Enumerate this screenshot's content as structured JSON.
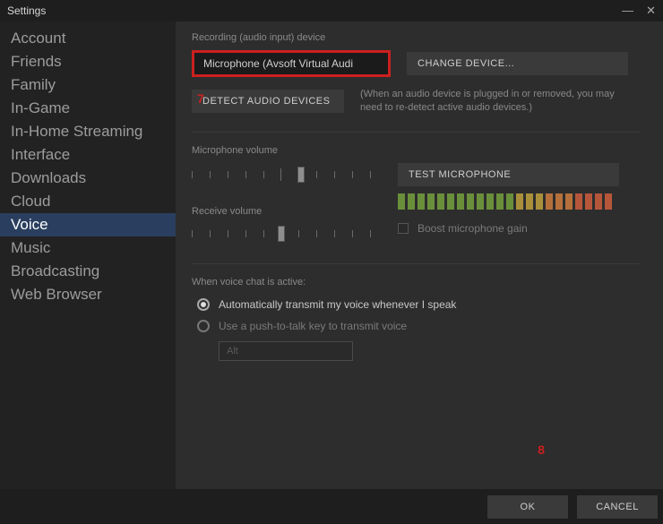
{
  "window": {
    "title": "Settings"
  },
  "sidebar": {
    "items": [
      "Account",
      "Friends",
      "Family",
      "In-Game",
      "In-Home Streaming",
      "Interface",
      "Downloads",
      "Cloud",
      "Voice",
      "Music",
      "Broadcasting",
      "Web Browser"
    ],
    "selected_index": 8
  },
  "voice": {
    "recording_device_label": "Recording (audio input) device",
    "recording_device_value": "Microphone (Avsoft Virtual Audi",
    "change_device_button": "CHANGE DEVICE...",
    "detect_button": "DETECT AUDIO DEVICES",
    "detect_hint": "(When an audio device is plugged in or removed, you may need to re-detect active audio devices.)",
    "mic_volume_label": "Microphone volume",
    "receive_volume_label": "Receive volume",
    "test_mic_button": "TEST MICROPHONE",
    "boost_gain_label": "Boost microphone gain",
    "boost_gain_checked": false,
    "voice_chat_section": "When voice chat is active:",
    "radio_auto": "Automatically transmit my voice whenever I speak",
    "radio_ptt": "Use a push-to-talk key to transmit voice",
    "radio_selected": "auto",
    "ptt_key": "Alt"
  },
  "buttons": {
    "ok": "OK",
    "cancel": "CANCEL"
  },
  "annotations": {
    "seven": "7",
    "eight": "8"
  }
}
